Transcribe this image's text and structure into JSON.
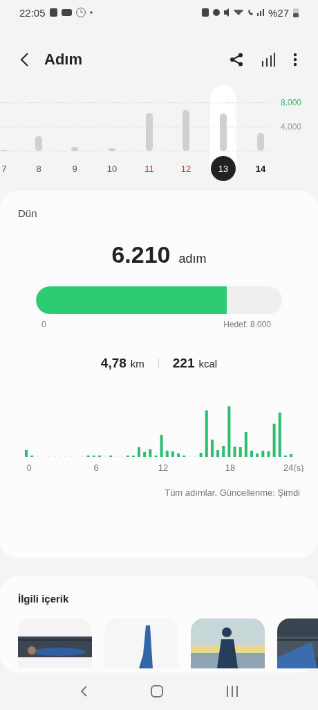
{
  "status_bar": {
    "time": "22:05",
    "battery": "%27"
  },
  "header": {
    "title": "Adım"
  },
  "week_chart": {
    "chart_data": {
      "type": "bar",
      "categories": [
        "7",
        "8",
        "9",
        "10",
        "11",
        "12",
        "13",
        "14"
      ],
      "values": [
        200,
        2500,
        700,
        500,
        6300,
        6800,
        6200,
        3000
      ],
      "ylim": [
        0,
        8000
      ],
      "yticks": [
        {
          "value": 4000,
          "label": "4.000"
        },
        {
          "value": 8000,
          "label": "8.000"
        }
      ]
    },
    "days": [
      {
        "selected": false,
        "weekend": false
      },
      {
        "selected": false,
        "weekend": false
      },
      {
        "selected": false,
        "weekend": false
      },
      {
        "selected": false,
        "weekend": false
      },
      {
        "selected": false,
        "weekend": true
      },
      {
        "selected": false,
        "weekend": true
      },
      {
        "selected": true,
        "weekend": false
      },
      {
        "selected": false,
        "weekend": false
      }
    ]
  },
  "summary": {
    "day": "Dün",
    "steps": "6.210",
    "steps_unit": "adım",
    "level": 0.776,
    "min_label": "0",
    "goal_label": "Hedef: 8.000",
    "distance": "4,78",
    "distance_unit": "km",
    "calories": "221",
    "calories_unit": "kcal",
    "hourly_ticks": [
      "0",
      "6",
      "12",
      "18",
      "24(s)"
    ],
    "footnote": "Tüm adımlar, Güncellenme: Şimdi"
  },
  "related": {
    "title": "İlgili içerik"
  }
}
